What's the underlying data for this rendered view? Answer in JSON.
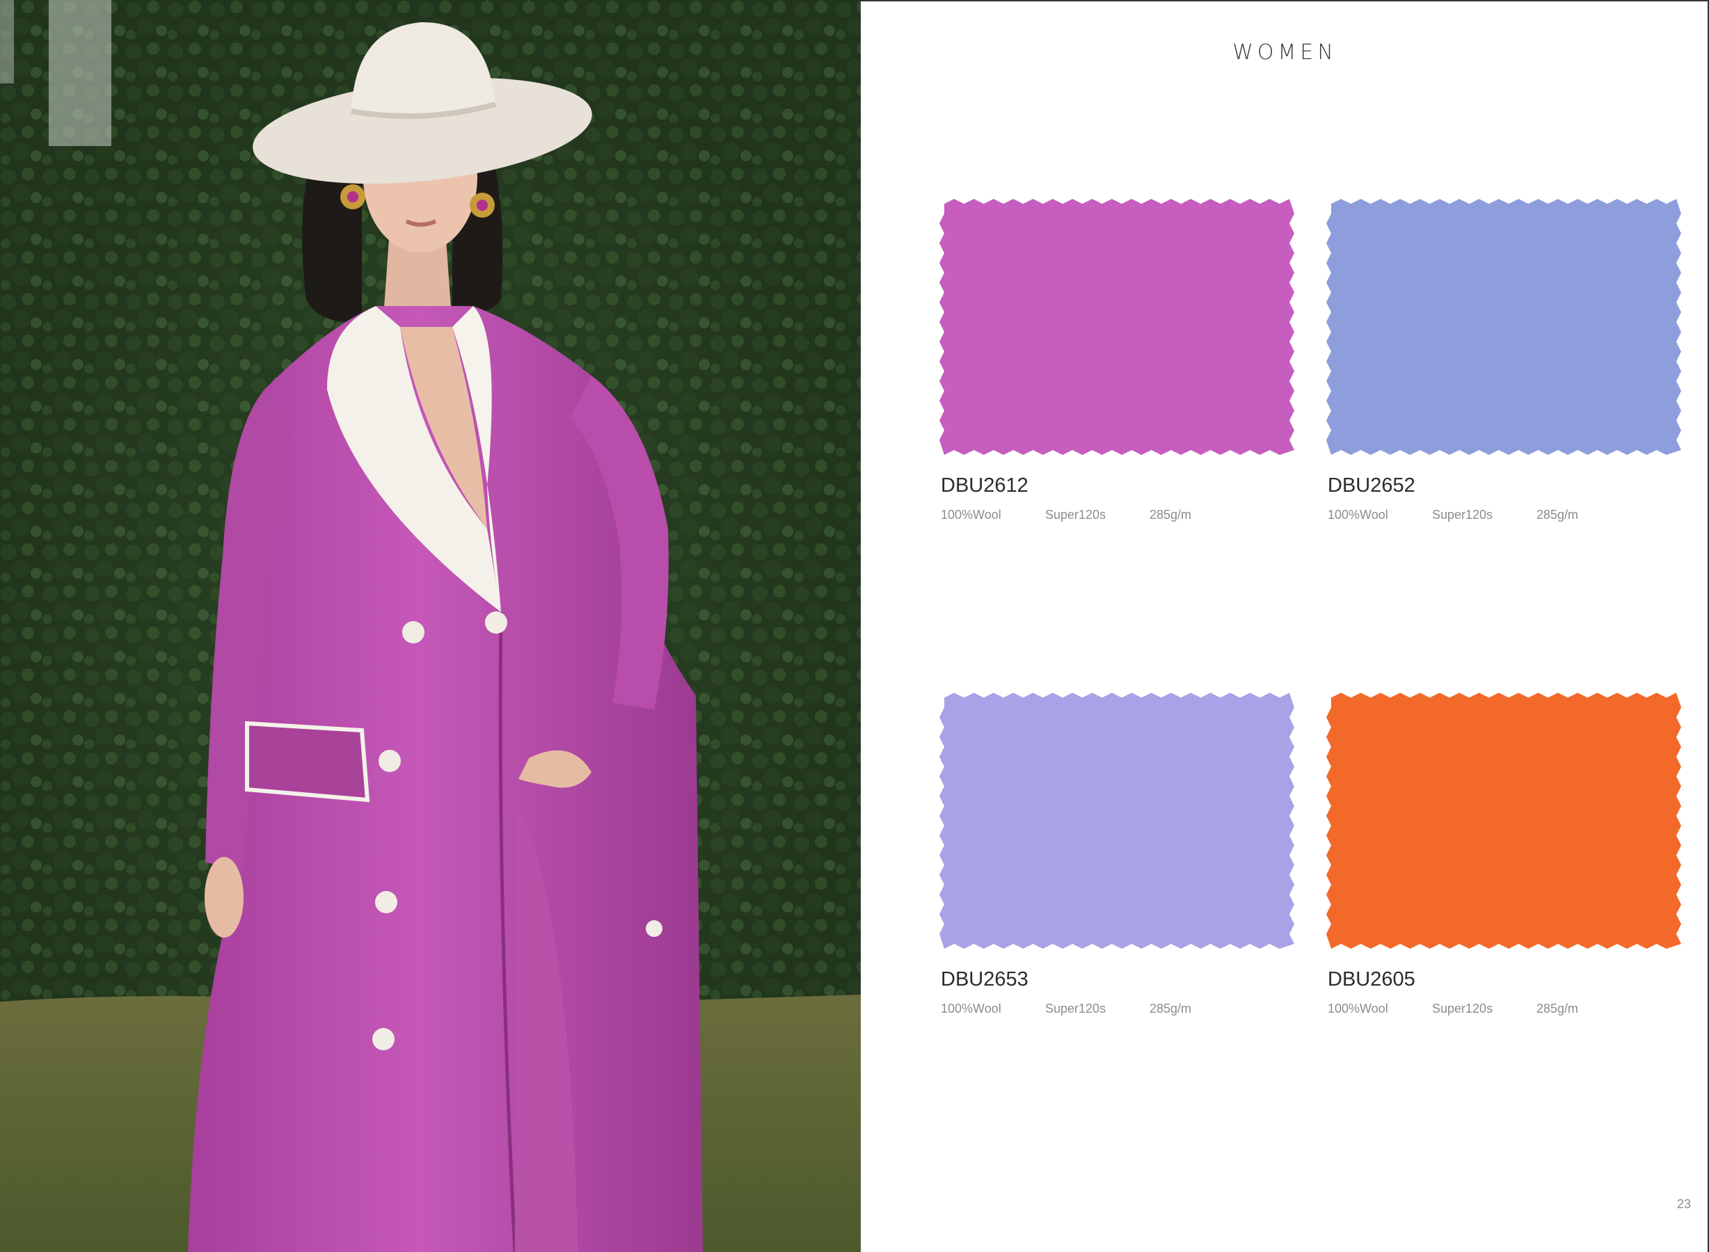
{
  "photo": {
    "subject": "fashion-photo-woman-in-orchid-double-breasted-coat"
  },
  "header": {
    "title": "WOMEN"
  },
  "swatches": [
    {
      "code": "DBU2612",
      "composition": "100%Wool",
      "quality": "Super120s",
      "weight": "285g/m",
      "color": "#C65DBF"
    },
    {
      "code": "DBU2652",
      "composition": "100%Wool",
      "quality": "Super120s",
      "weight": "285g/m",
      "color": "#8E9EDC"
    },
    {
      "code": "DBU2653",
      "composition": "100%Wool",
      "quality": "Super120s",
      "weight": "285g/m",
      "color": "#A9A2E6"
    },
    {
      "code": "DBU2605",
      "composition": "100%Wool",
      "quality": "Super120s",
      "weight": "285g/m",
      "color": "#F2692A"
    }
  ],
  "footer": {
    "page_number": "23"
  }
}
